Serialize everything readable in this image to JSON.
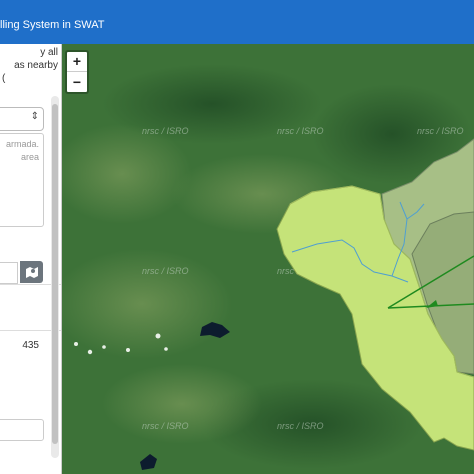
{
  "header": {
    "title": "lling System in SWAT"
  },
  "sidebar": {
    "help_lines": [
      "y all",
      "as nearby",
      "("
    ],
    "textarea_lines": [
      "armada.",
      "area"
    ],
    "value": "435"
  },
  "map": {
    "zoom_in": "+",
    "zoom_out": "−",
    "watermark": "nrsc / ISRO"
  },
  "colors": {
    "header": "#1f6fc9",
    "watershed_main": "#c5e379",
    "watershed_dark": "#a7bf86",
    "stream": "#4f9fd1",
    "flow_lines": "#1f8a1f"
  }
}
